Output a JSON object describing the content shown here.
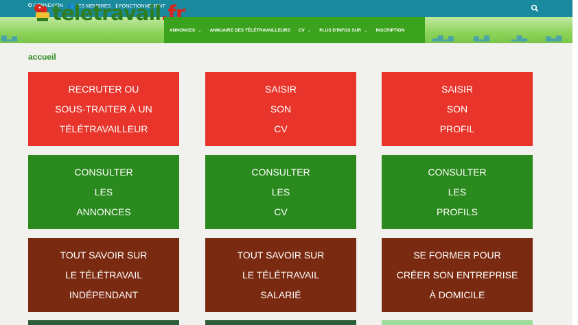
{
  "topbar": {
    "links": [
      {
        "icon": "power-icon",
        "label": "CONNEXION"
      },
      {
        "icon": "users-icon",
        "label": "LES MEMBRES"
      },
      {
        "icon": "info-icon",
        "label": "FONCTIONNEMENT"
      }
    ]
  },
  "logo": {
    "word": "teletravail",
    "suffix": ".fr"
  },
  "menu": {
    "items": [
      {
        "label": "ANNONCES",
        "dropdown": true
      },
      {
        "label": "ANNUAIRE DES TÉLÉTRAVAILLEURS",
        "dropdown": false
      },
      {
        "label": "CV",
        "dropdown": true
      },
      {
        "label": "PLUS D'INFOS SUR",
        "dropdown": true
      },
      {
        "label": "INSCRIPTION",
        "dropdown": false
      }
    ],
    "caret": "⌄"
  },
  "breadcrumb": "accueil",
  "tiles": [
    {
      "lines": [
        "RECRUTER OU",
        "SOUS-TRAITER À UN",
        "TÉLÉTRAVAILLEUR"
      ],
      "color": "red"
    },
    {
      "lines": [
        "SAISIR",
        "SON",
        "CV"
      ],
      "color": "red"
    },
    {
      "lines": [
        "SAISIR",
        "SON",
        "PROFIL"
      ],
      "color": "red"
    },
    {
      "lines": [
        "CONSULTER",
        "LES",
        "ANNONCES"
      ],
      "color": "green"
    },
    {
      "lines": [
        "CONSULTER",
        "LES",
        "CV"
      ],
      "color": "green"
    },
    {
      "lines": [
        "CONSULTER",
        "LES",
        "PROFILS"
      ],
      "color": "green"
    },
    {
      "lines": [
        "TOUT SAVOIR SUR",
        "LE TÉLÉTRAVAIL",
        "INDÉPENDANT"
      ],
      "color": "brown"
    },
    {
      "lines": [
        "TOUT SAVOIR SUR",
        "LE TÉLÉTRAVAIL",
        "SALARIÉ"
      ],
      "color": "brown"
    },
    {
      "lines": [
        "SE FORMER POUR",
        "CRÉER SON ENTREPRISE",
        "À DOMICILE"
      ],
      "color": "brown"
    }
  ],
  "colors": {
    "topbar": "#1a8a9e",
    "menu": "#3aa21c",
    "red": "#e8342a",
    "green": "#2a8a1d",
    "brown": "#7a2a10",
    "dark_green": "#2f5e3a",
    "light_green": "#9fdd9a"
  }
}
